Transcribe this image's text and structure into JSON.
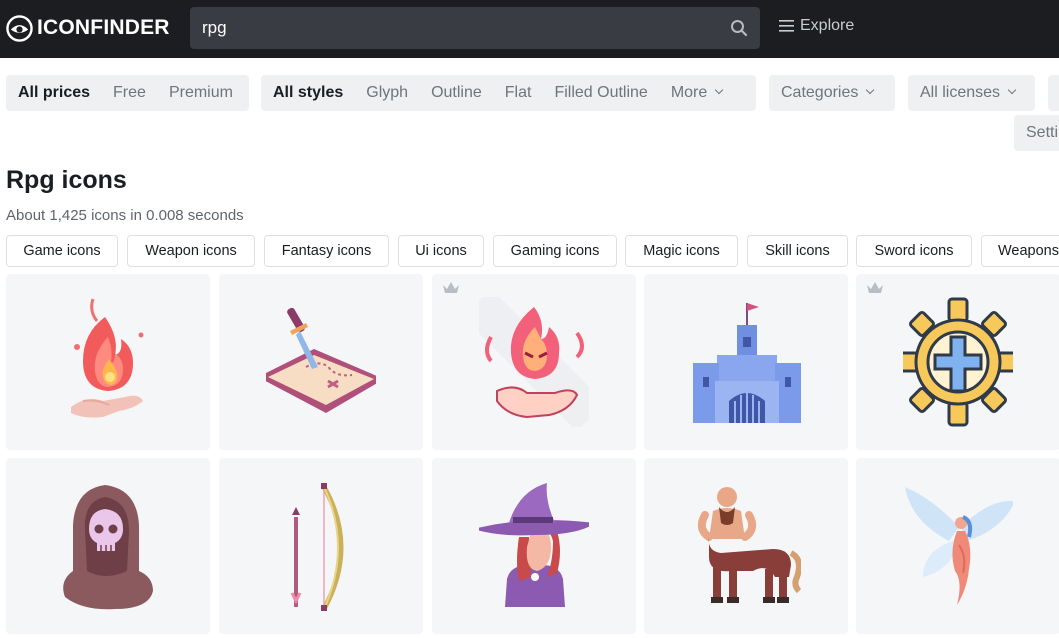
{
  "header": {
    "logo_text": "ICONFINDER",
    "search_value": "rpg",
    "explore_label": "Explore"
  },
  "filters": {
    "price": [
      "All prices",
      "Free",
      "Premium"
    ],
    "styles": [
      "All styles",
      "Glyph",
      "Outline",
      "Flat",
      "Filled Outline",
      "More"
    ],
    "categories_label": "Categories",
    "licenses_label": "All licenses",
    "settings_label": "Setti"
  },
  "results": {
    "title": "Rpg icons",
    "count_text": "About 1,425 icons in 0.008 seconds"
  },
  "related_tags": [
    "Game icons",
    "Weapon icons",
    "Fantasy icons",
    "Ui icons",
    "Gaming icons",
    "Magic icons",
    "Skill icons",
    "Sword icons",
    "Weapons"
  ],
  "icons": [
    {
      "name": "fire-magic-hand",
      "premium": false
    },
    {
      "name": "treasure-map-sword",
      "premium": false
    },
    {
      "name": "fire-spirit-hand",
      "premium": true
    },
    {
      "name": "castle",
      "premium": false
    },
    {
      "name": "holy-cross-gear",
      "premium": true
    },
    {
      "name": "hooded-skull",
      "premium": false
    },
    {
      "name": "bow-arrow",
      "premium": false
    },
    {
      "name": "witch",
      "premium": false
    },
    {
      "name": "centaur",
      "premium": false
    },
    {
      "name": "fairy",
      "premium": false
    }
  ],
  "colors": {
    "topbar": "#1b1d20",
    "search_bg": "#393d43",
    "filter_bg": "#eef0f2",
    "tile_bg": "#f5f6f8",
    "premium_crown": "#b9bec4"
  }
}
